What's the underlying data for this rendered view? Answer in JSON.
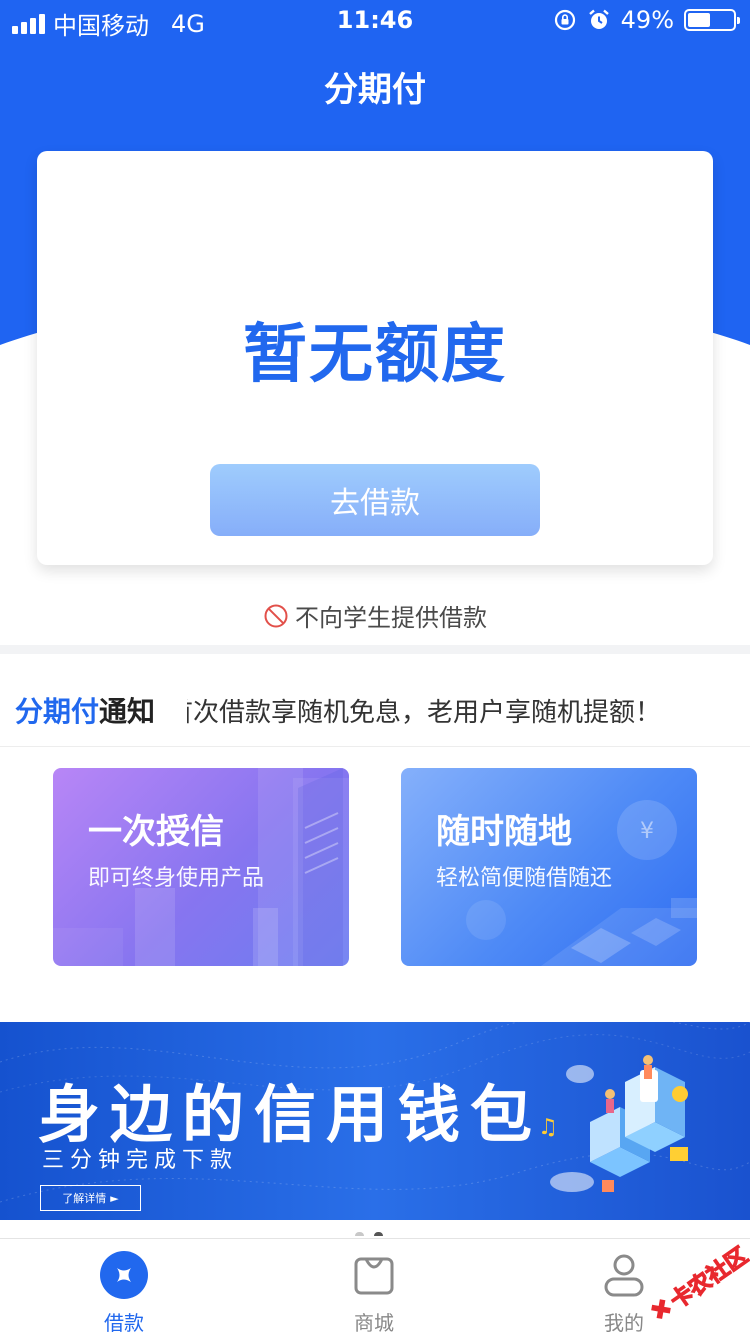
{
  "status_bar": {
    "carrier": "中国移动",
    "network": "4G",
    "time": "11:46",
    "battery": "49%",
    "battery_level": 0.49
  },
  "header": {
    "title": "分期付"
  },
  "credit_card": {
    "status": "暂无额度",
    "button_label": "去借款"
  },
  "notice": {
    "text": "不向学生提供借款"
  },
  "announcement": {
    "label_brand": "分期付",
    "label_suffix": "通知",
    "text": "首次借款享随机免息，老用户享随机提额！"
  },
  "features": [
    {
      "title": "一次授信",
      "subtitle": "即可终身使用产品"
    },
    {
      "title": "随时随地",
      "subtitle": "轻松简便随借随还"
    }
  ],
  "banner": {
    "title": "身边的信用钱包",
    "subtitle": "三分钟完成下款",
    "button_label": "了解详情"
  },
  "tabs": [
    {
      "label": "借款",
      "icon": "loan-icon",
      "active": true
    },
    {
      "label": "商城",
      "icon": "shopping-bag-icon",
      "active": false
    },
    {
      "label": "我的",
      "icon": "user-icon",
      "active": false
    }
  ],
  "watermark": {
    "text": "卡农社区"
  },
  "colors": {
    "primary": "#1f64f2",
    "status_text": "#2168ee",
    "button_gradient_start": "#9fccfd",
    "button_gradient_end": "#86aef9"
  }
}
